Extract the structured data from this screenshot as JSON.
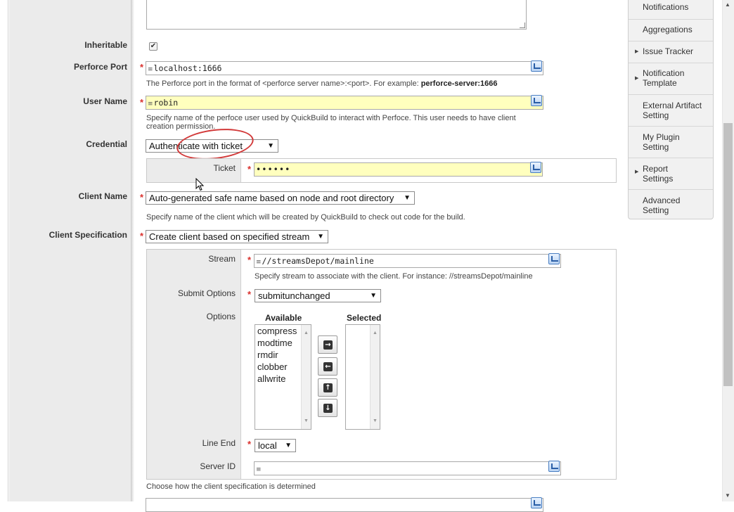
{
  "labels": {
    "inheritable": "Inheritable",
    "perforce_port": "Perforce Port",
    "user_name": "User Name",
    "credential": "Credential",
    "client_name": "Client Name",
    "client_spec": "Client Specification",
    "ticket": "Ticket",
    "stream": "Stream",
    "submit_options": "Submit Options",
    "options": "Options",
    "line_end": "Line End",
    "server_id": "Server ID"
  },
  "required_mark": "*",
  "inheritable_checked_glyph": "✔",
  "perforce_port": {
    "value": "localhost:1666",
    "help": "The Perforce port in the format of <perforce server name>:<port>. For example: ",
    "help_example": "perforce-server:1666"
  },
  "user_name": {
    "value": "robin",
    "help": "Specify name of the perfoce user used by QuickBuild to interact with Perfoce. This user needs to have client creation permission."
  },
  "credential": {
    "selected": "Authenticate with ticket"
  },
  "ticket": {
    "value": "••••••"
  },
  "client_name": {
    "selected": "Auto-generated safe name based on node and root directory",
    "help": "Specify name of the client which will be created by QuickBuild to check out code for the build."
  },
  "client_spec": {
    "selected": "Create client based on specified stream",
    "help": "Choose how the client specification is determined"
  },
  "stream": {
    "value": "//streamsDepot/mainline",
    "help": "Specify stream to associate with the client. For instance: //streamsDepot/mainline"
  },
  "submit_options": {
    "selected": "submitunchanged"
  },
  "options": {
    "available_header": "Available",
    "selected_header": "Selected",
    "available": [
      "compress",
      "modtime",
      "rmdir",
      "clobber",
      "allwrite"
    ],
    "selected": []
  },
  "line_end": {
    "selected": "local"
  },
  "server_id": {
    "value": ""
  },
  "sidebar": {
    "items": [
      {
        "label": "Notifications",
        "arrow": false
      },
      {
        "label": "Aggregations",
        "arrow": false
      },
      {
        "label": "Issue Tracker",
        "arrow": true
      },
      {
        "label": "Notification Template",
        "arrow": true
      },
      {
        "label": "External Artifact Setting",
        "arrow": false
      },
      {
        "label": "My Plugin Setting",
        "arrow": false
      },
      {
        "label": "Report Settings",
        "arrow": true
      },
      {
        "label": "Advanced Setting",
        "arrow": false
      }
    ]
  },
  "colors": {
    "required": "#d9302c",
    "input_highlight": "#ffffbe",
    "callout": "#d23a3a"
  },
  "icons": {
    "caret": "▼",
    "side_arrow": "▶",
    "move_right": "→",
    "move_left": "←",
    "move_up": "↑",
    "move_down": "↓",
    "lines": "≡",
    "scroll_up": "▲",
    "scroll_down": "▼"
  }
}
